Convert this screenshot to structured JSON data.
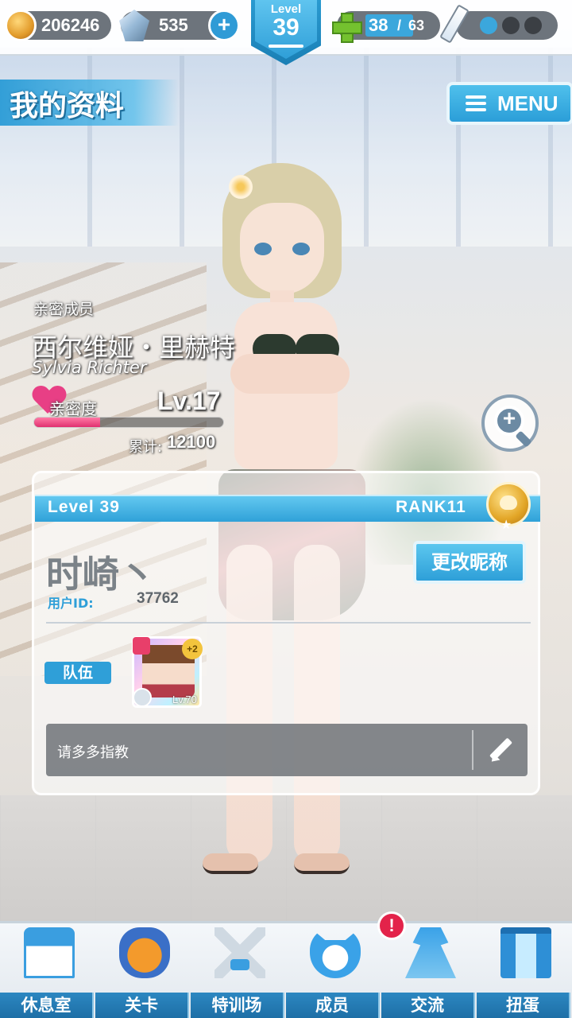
{
  "hud": {
    "coins": "206246",
    "gems": "535",
    "level_label": "Level",
    "level_value": "39",
    "stamina_current": "38",
    "stamina_separator": "/",
    "stamina_max": "63"
  },
  "header": {
    "title": "我的资料",
    "menu_label": "MENU"
  },
  "bond_member": {
    "caption": "亲密成员",
    "name_cn": "西尔维娅・里赫特",
    "name_en": "Sylvia Richter",
    "affection_label": "亲密度",
    "affection_level": "Lv.17",
    "affection_progress": 0.35,
    "total_label": "累计:",
    "total_value": "12100"
  },
  "profile": {
    "level_text": "Level 39",
    "rank_text": "RANK11",
    "nickname": "时崎丶",
    "rename_label": "更改昵称",
    "uid_label": "用户ID:",
    "uid_value": "37762",
    "team_label": "队伍",
    "team_card": {
      "plus": "+2",
      "level": "Lv.70"
    },
    "comment": "请多多指教"
  },
  "bottom_nav": {
    "items": [
      {
        "label": "休息室",
        "icon": "school-icon"
      },
      {
        "label": "关卡",
        "icon": "demon-icon"
      },
      {
        "label": "特训场",
        "icon": "crossed-swords-icon"
      },
      {
        "label": "成员",
        "icon": "cat-mascot-icon"
      },
      {
        "label": "交流",
        "icon": "dress-icon"
      },
      {
        "label": "扭蛋",
        "icon": "curtain-icon"
      }
    ],
    "notification": "!"
  },
  "colors": {
    "accent": "#2f9fd8",
    "affection": "#e83f85",
    "notification": "#e3234a"
  }
}
